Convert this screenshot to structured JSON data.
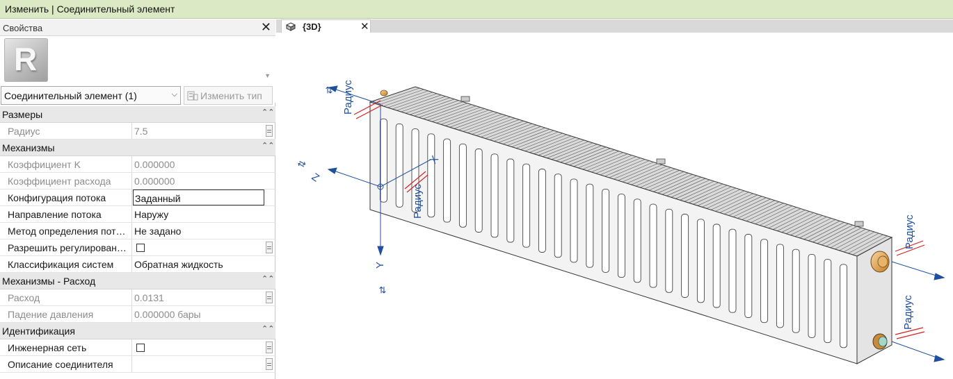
{
  "ribbon": {
    "title": "Изменить | Соединительный элемент"
  },
  "properties": {
    "header": "Свойства",
    "close_glyph": "✕",
    "type_selector": "Соединительный элемент (1)",
    "edit_type_label": "Изменить тип",
    "logo_letter": "R",
    "icons": {
      "logo": "revit-logo-icon",
      "edit_type": "edit-type-icon",
      "dropdown": "chevron-down-icon"
    }
  },
  "sections": [
    {
      "title": "Размеры",
      "rows": [
        {
          "name": "Радиус",
          "value": "7.5"
        }
      ]
    },
    {
      "title": "Механизмы",
      "rows": [
        {
          "name": "Коэффициент K",
          "value": "0.000000"
        },
        {
          "name": "Коэффициент расхода",
          "value": "0.000000"
        },
        {
          "name": "Конфигурация потока",
          "value": "Заданный"
        },
        {
          "name": "Направление потока",
          "value": "Наружу"
        },
        {
          "name": "Метод определения пот…",
          "value": "Не задано"
        },
        {
          "name": "Разрешить регулирован…",
          "value": ""
        },
        {
          "name": "Классификация систем",
          "value": "Обратная жидкость"
        }
      ]
    },
    {
      "title": "Механизмы - Расход",
      "rows": [
        {
          "name": "Расход",
          "value": "0.0131"
        },
        {
          "name": "Падение давления",
          "value": "0.000000 бары"
        }
      ]
    },
    {
      "title": "Идентификация",
      "rows": [
        {
          "name": "Инженерная сеть",
          "value": ""
        },
        {
          "name": "Описание соединителя",
          "value": ""
        }
      ]
    }
  ],
  "view": {
    "tab_label": "{3D}",
    "tab_close": "✕",
    "tab_icon": "cube-3d-icon",
    "annotations": {
      "radius": "Радиус",
      "axis_x": "X",
      "axis_y": "Y",
      "axis_z": "Z"
    }
  },
  "colors": {
    "ribbon": "#dbe9c4",
    "section": "#e8e8e8",
    "axis_blue": "#1f4f9e",
    "radius_red": "#d42020",
    "connector_orange": "#e8a244"
  }
}
